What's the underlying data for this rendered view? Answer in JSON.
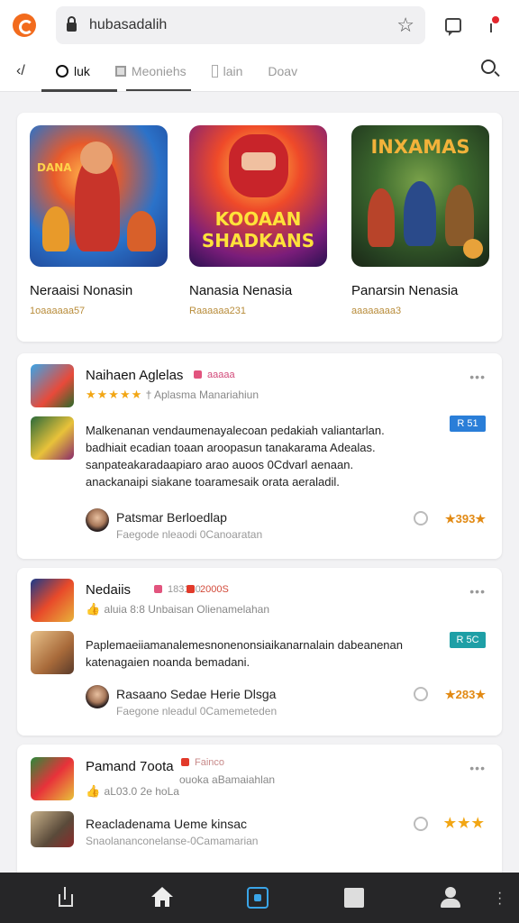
{
  "browser": {
    "url": "hubasadalih",
    "icons": [
      "app-logo-icon",
      "lock-icon",
      "star-icon",
      "chat-icon",
      "notification-icon"
    ]
  },
  "tabs": {
    "back_label": "‹/",
    "items": [
      {
        "label": "luk",
        "icon": "ring-icon",
        "active": true
      },
      {
        "label": "Meoniehs",
        "icon": "grid-icon",
        "active": false
      },
      {
        "label": "lain",
        "icon": "panel-icon",
        "active": false
      },
      {
        "label": "Doav",
        "icon": "",
        "active": false
      }
    ]
  },
  "featured": [
    {
      "title": "Neraaisi Nonasin",
      "meta": "1oaaaaaa57",
      "cover_text": "DANA"
    },
    {
      "title": "Nanasia Nenasia",
      "meta": "Raaaaaa231",
      "cover_text": "KOOAAN SHADKANS"
    },
    {
      "title": "Panarsin Nenasia",
      "meta": "aaaaaaaa3",
      "cover_text": "INXAMAS"
    }
  ],
  "reviews": [
    {
      "app_name": "Naihaen Aglelas",
      "badge": "aaaaa",
      "stars": "★★★★★",
      "rating_text": "† Aplasma Manariahiun",
      "body": "Malkenanan vendaumenayalecoan pedakiah valiantarlan. badhiait ecadian toaan aroopasun tanakarama Adealas. sanpateakaradaapiaro arao auoos 0Cdvarl aenaan. anackanaipi siakane toaramesaik orata aeraladil.",
      "tag": "R 51",
      "author": "Patsmar Berloedlap",
      "author_sub": "Faegode nleaodi 0Canoaratan",
      "score": "★393★"
    },
    {
      "app_name": "Nedaiis",
      "badge_pink": "183130",
      "badge": "2000S",
      "stars": "👍",
      "rating_text": "aluia 8:8 Unbaisan Olienamelahan",
      "body": "Paplemaeiiamanalemesnonenonsiaikanarnalain dabeanenan katenagaien noanda bemadani.",
      "tag": "R 5C",
      "author": "Rasaano Sedae Herie Dlsga",
      "author_sub": "Faegone nleadul 0Camemeteden",
      "score": "★283★"
    },
    {
      "app_name": "Pamand 7oota",
      "badge": "Fainco",
      "badge_sub": "ouoka aBamaiahlan",
      "stars": "👍",
      "rating_text": "aL03.0 2e hoLa",
      "second_title": "Reacladenama Ueme kinsac",
      "second_sub": "Snaolananconelanse-0Camamarian",
      "score": "★★★"
    }
  ],
  "bottom_nav": [
    "share-icon",
    "home-icon",
    "tabs-icon",
    "square-icon",
    "profile-icon",
    "menu-icon"
  ]
}
